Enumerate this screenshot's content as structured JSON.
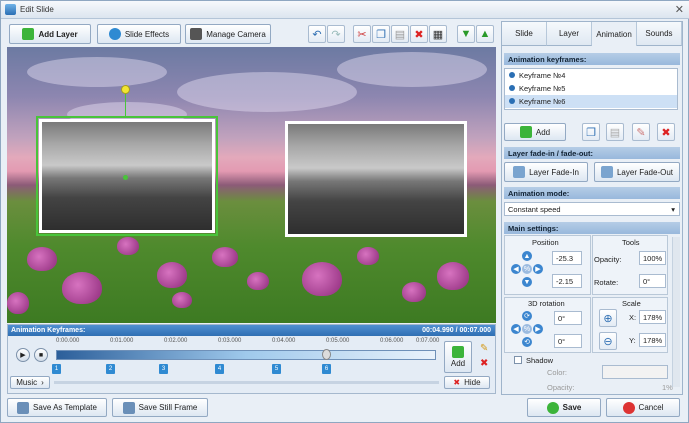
{
  "window": {
    "title": "Edit Slide"
  },
  "toolbar": {
    "add_layer": "Add Layer",
    "slide_effects": "Slide Effects",
    "manage_camera": "Manage Camera"
  },
  "tabs": [
    "Slide",
    "Layer",
    "Animation",
    "Sounds"
  ],
  "animation_keyframes_section": "Animation keyframes:",
  "keyframes": [
    "Keyframe №4",
    "Keyframe №5",
    "Keyframe №6"
  ],
  "add_label": "Add",
  "fade_section": "Layer fade-in / fade-out:",
  "fade_in": "Layer Fade-In",
  "fade_out": "Layer Fade-Out",
  "animation_mode_section": "Animation mode:",
  "animation_mode_value": "Constant speed",
  "main_settings_section": "Main settings:",
  "position_label": "Position",
  "tools_label": "Tools",
  "pos_x": "-25.3",
  "pos_y": "-2.15",
  "opacity_label": "Opacity:",
  "opacity_value": "100%",
  "rotate_label": "Rotate:",
  "rotate_value": "0°",
  "rotation3d_label": "3D rotation",
  "scale_label": "Scale",
  "rot3d_x": "0°",
  "rot3d_y": "0°",
  "scale_x_label": "X:",
  "scale_x": "178%",
  "scale_y_label": "Y:",
  "scale_y": "178%",
  "shadow_label": "Shadow",
  "color_label": "Color:",
  "shadow_opacity_label": "Opacity:",
  "shadow_opacity_value": "1%",
  "timeline": {
    "title": "Animation Keyframes:",
    "time": "00:04.990 / 00:07.000",
    "ticks": [
      "0:00.000",
      "0:01.000",
      "0:02.000",
      "0:03.000",
      "0:04.000",
      "0:05.000",
      "0:06.000",
      "0:07.000"
    ],
    "keyframe_numbers": [
      "1",
      "2",
      "3",
      "4",
      "5",
      "6"
    ],
    "add": "Add",
    "hide": "Hide",
    "music": "Music"
  },
  "footer": {
    "save_template": "Save As Template",
    "save_still": "Save Still Frame",
    "save": "Save",
    "cancel": "Cancel"
  },
  "colors": {
    "accent": "#2f6fb3",
    "selection": "#49c43a",
    "anchor": "#f2e531"
  }
}
